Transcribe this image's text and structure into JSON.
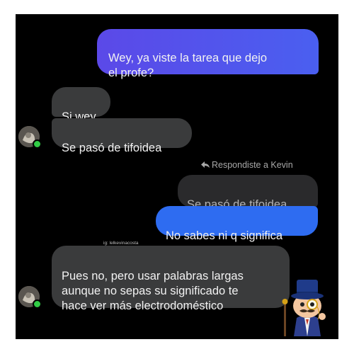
{
  "messages": {
    "sent_1": "Wey, ya viste la tarea que dejo\nel profe?",
    "recv_1": "Si wey",
    "recv_2": "Se pasó de tifoidea",
    "reply_label": "Respondiste a Kevin",
    "quoted": "Se pasó de tifoidea",
    "sent_2": "No sabes ni q significa",
    "watermark": "ig: lelkevinacosta",
    "recv_3": "Pues no, pero usar palabras largas\naunque no sepas su significado te\nhace ver más electrodoméstico"
  },
  "icons": {
    "reply": "reply-arrow-icon",
    "avatar": "user-avatar",
    "online": "online-dot-icon",
    "sticker": "monocle-gentleman-sticker"
  },
  "colors": {
    "background": "#000000",
    "sent_bubble": "#4a5ff0",
    "received_bubble": "#3a3b3c",
    "quoted_bubble": "#2a2a2c",
    "online": "#31cc46"
  }
}
